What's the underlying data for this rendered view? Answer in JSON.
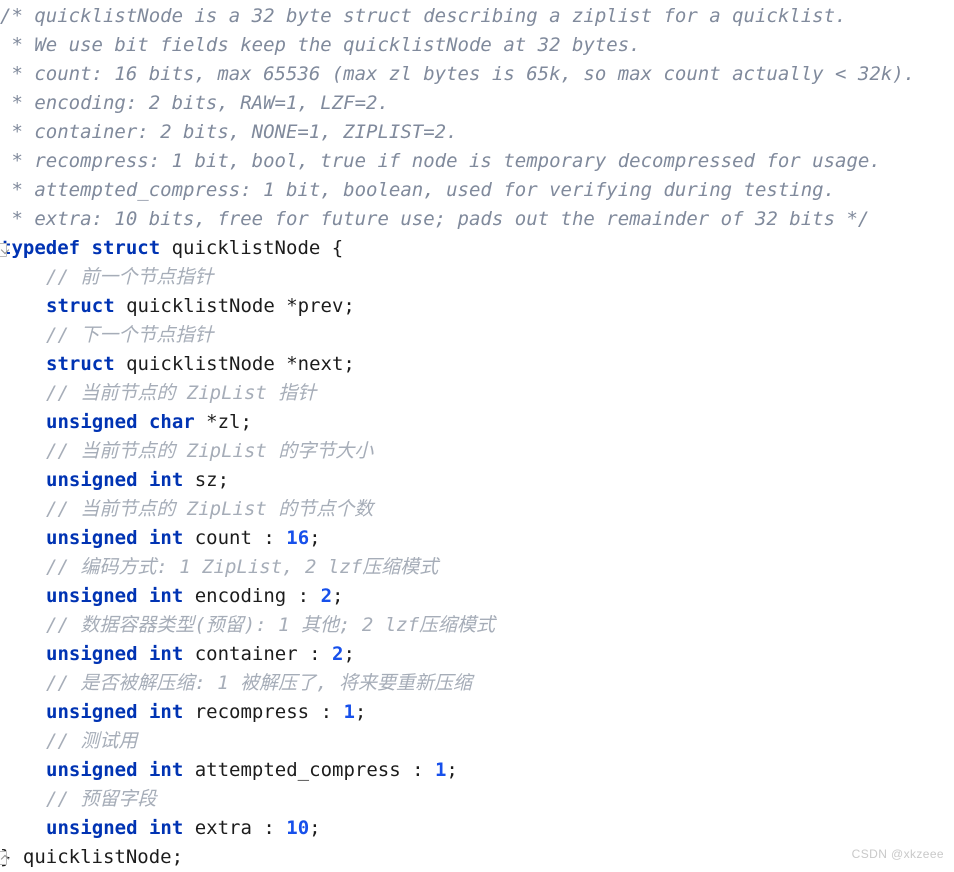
{
  "editor": {
    "language": "c",
    "background_color": "#ffffff",
    "colors": {
      "block_comment": "#808a9c",
      "line_comment": "#a6adb8",
      "keyword": "#0033b3",
      "plain_text": "#1c1c1c",
      "number": "#1750eb"
    },
    "fold_markers": [
      {
        "name": "fold-typedef-struct",
        "state": "expanded"
      },
      {
        "name": "fold-struct-end",
        "state": "expanded"
      }
    ]
  },
  "code": {
    "lines": [
      {
        "indent": 0,
        "tokens": [
          {
            "t": "blockcomment",
            "s": "/* quicklistNode is a 32 byte struct describing a ziplist for a quicklist."
          }
        ]
      },
      {
        "indent": 0,
        "tokens": [
          {
            "t": "blockcomment",
            "s": " * We use bit fields keep the quicklistNode at 32 bytes."
          }
        ]
      },
      {
        "indent": 0,
        "tokens": [
          {
            "t": "blockcomment",
            "s": " * count: 16 bits, max 65536 (max zl bytes is 65k, so max count actually < 32k)."
          }
        ]
      },
      {
        "indent": 0,
        "tokens": [
          {
            "t": "blockcomment",
            "s": " * encoding: 2 bits, RAW=1, LZF=2."
          }
        ]
      },
      {
        "indent": 0,
        "tokens": [
          {
            "t": "blockcomment",
            "s": " * container: 2 bits, NONE=1, ZIPLIST=2."
          }
        ]
      },
      {
        "indent": 0,
        "tokens": [
          {
            "t": "blockcomment",
            "s": " * recompress: 1 bit, bool, true if node is temporary decompressed for usage."
          }
        ]
      },
      {
        "indent": 0,
        "tokens": [
          {
            "t": "blockcomment",
            "s": " * attempted_compress: 1 bit, boolean, used for verifying during testing."
          }
        ]
      },
      {
        "indent": 0,
        "tokens": [
          {
            "t": "blockcomment",
            "s": " * extra: 10 bits, free for future use; pads out the remainder of 32 bits */"
          }
        ]
      },
      {
        "indent": 0,
        "fold": "open",
        "tokens": [
          {
            "t": "keyword",
            "s": "typedef"
          },
          {
            "t": "plain",
            "s": " "
          },
          {
            "t": "keyword",
            "s": "struct"
          },
          {
            "t": "plain",
            "s": " quicklistNode {"
          }
        ]
      },
      {
        "indent": 1,
        "tokens": [
          {
            "t": "linecomment",
            "s": "// 前一个节点指针"
          }
        ]
      },
      {
        "indent": 1,
        "tokens": [
          {
            "t": "keyword",
            "s": "struct"
          },
          {
            "t": "plain",
            "s": " quicklistNode *prev;"
          }
        ]
      },
      {
        "indent": 1,
        "tokens": [
          {
            "t": "linecomment",
            "s": "// 下一个节点指针"
          }
        ]
      },
      {
        "indent": 1,
        "tokens": [
          {
            "t": "keyword",
            "s": "struct"
          },
          {
            "t": "plain",
            "s": " quicklistNode *next;"
          }
        ]
      },
      {
        "indent": 1,
        "tokens": [
          {
            "t": "linecomment",
            "s": "// 当前节点的 ZipList 指针"
          }
        ]
      },
      {
        "indent": 1,
        "tokens": [
          {
            "t": "keyword",
            "s": "unsigned"
          },
          {
            "t": "plain",
            "s": " "
          },
          {
            "t": "keyword",
            "s": "char"
          },
          {
            "t": "plain",
            "s": " *zl;"
          }
        ]
      },
      {
        "indent": 1,
        "tokens": [
          {
            "t": "linecomment",
            "s": "// 当前节点的 ZipList 的字节大小"
          }
        ]
      },
      {
        "indent": 1,
        "tokens": [
          {
            "t": "keyword",
            "s": "unsigned"
          },
          {
            "t": "plain",
            "s": " "
          },
          {
            "t": "keyword",
            "s": "int"
          },
          {
            "t": "plain",
            "s": " sz;"
          }
        ]
      },
      {
        "indent": 1,
        "tokens": [
          {
            "t": "linecomment",
            "s": "// 当前节点的 ZipList 的节点个数"
          }
        ]
      },
      {
        "indent": 1,
        "tokens": [
          {
            "t": "keyword",
            "s": "unsigned"
          },
          {
            "t": "plain",
            "s": " "
          },
          {
            "t": "keyword",
            "s": "int"
          },
          {
            "t": "plain",
            "s": " count : "
          },
          {
            "t": "number",
            "s": "16"
          },
          {
            "t": "plain",
            "s": ";"
          }
        ]
      },
      {
        "indent": 1,
        "tokens": [
          {
            "t": "linecomment",
            "s": "// 编码方式: 1 ZipList, 2 lzf压缩模式"
          }
        ]
      },
      {
        "indent": 1,
        "tokens": [
          {
            "t": "keyword",
            "s": "unsigned"
          },
          {
            "t": "plain",
            "s": " "
          },
          {
            "t": "keyword",
            "s": "int"
          },
          {
            "t": "plain",
            "s": " encoding : "
          },
          {
            "t": "number",
            "s": "2"
          },
          {
            "t": "plain",
            "s": ";"
          }
        ]
      },
      {
        "indent": 1,
        "tokens": [
          {
            "t": "linecomment",
            "s": "// 数据容器类型(预留): 1 其他; 2 lzf压缩模式"
          }
        ]
      },
      {
        "indent": 1,
        "tokens": [
          {
            "t": "keyword",
            "s": "unsigned"
          },
          {
            "t": "plain",
            "s": " "
          },
          {
            "t": "keyword",
            "s": "int"
          },
          {
            "t": "plain",
            "s": " container : "
          },
          {
            "t": "number",
            "s": "2"
          },
          {
            "t": "plain",
            "s": ";"
          }
        ]
      },
      {
        "indent": 1,
        "tokens": [
          {
            "t": "linecomment",
            "s": "// 是否被解压缩: 1 被解压了, 将来要重新压缩"
          }
        ]
      },
      {
        "indent": 1,
        "tokens": [
          {
            "t": "keyword",
            "s": "unsigned"
          },
          {
            "t": "plain",
            "s": " "
          },
          {
            "t": "keyword",
            "s": "int"
          },
          {
            "t": "plain",
            "s": " recompress : "
          },
          {
            "t": "number",
            "s": "1"
          },
          {
            "t": "plain",
            "s": ";"
          }
        ]
      },
      {
        "indent": 1,
        "tokens": [
          {
            "t": "linecomment",
            "s": "// 测试用"
          }
        ]
      },
      {
        "indent": 1,
        "tokens": [
          {
            "t": "keyword",
            "s": "unsigned"
          },
          {
            "t": "plain",
            "s": " "
          },
          {
            "t": "keyword",
            "s": "int"
          },
          {
            "t": "plain",
            "s": " attempted_compress : "
          },
          {
            "t": "number",
            "s": "1"
          },
          {
            "t": "plain",
            "s": ";"
          }
        ]
      },
      {
        "indent": 1,
        "tokens": [
          {
            "t": "linecomment",
            "s": "// 预留字段"
          }
        ]
      },
      {
        "indent": 1,
        "tokens": [
          {
            "t": "keyword",
            "s": "unsigned"
          },
          {
            "t": "plain",
            "s": " "
          },
          {
            "t": "keyword",
            "s": "int"
          },
          {
            "t": "plain",
            "s": " extra : "
          },
          {
            "t": "number",
            "s": "10"
          },
          {
            "t": "plain",
            "s": ";"
          }
        ]
      },
      {
        "indent": 0,
        "fold": "close",
        "tokens": [
          {
            "t": "plain",
            "s": "} quicklistNode;"
          }
        ]
      }
    ]
  },
  "watermark": {
    "text": "CSDN @xkzeee"
  }
}
